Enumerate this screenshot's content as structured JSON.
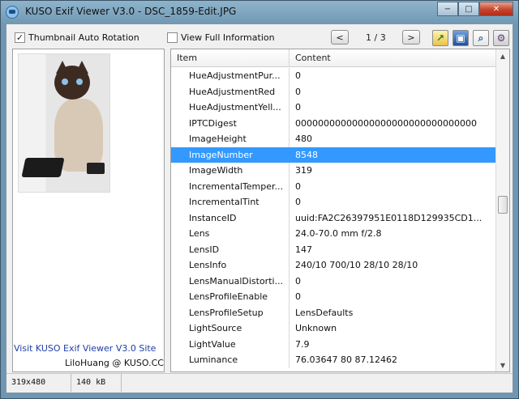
{
  "window": {
    "title": "KUSO Exif Viewer V3.0 - DSC_1859-Edit.JPG",
    "buttons": {
      "minimize": "−",
      "maximize": "□",
      "close": "✕"
    }
  },
  "toolbar": {
    "thumbnail_auto_rotation": {
      "label": "Thumbnail Auto Rotation",
      "checked": true,
      "mark": "✓"
    },
    "view_full_information": {
      "label": "View Full Information",
      "checked": false,
      "mark": ""
    },
    "prev_glyph": "<",
    "next_glyph": ">",
    "page_indicator": "1 / 3",
    "tools": [
      "open-folder-icon",
      "save-icon",
      "search-icon",
      "settings-icon"
    ]
  },
  "left_panel": {
    "site_link": "Visit KUSO Exif Viewer V3.0 Site",
    "credit": "LiloHuang @ KUSO.CC"
  },
  "table": {
    "columns": [
      "Item",
      "Content"
    ],
    "rows": [
      {
        "item": "HueAdjustmentPur...",
        "content": "0"
      },
      {
        "item": "HueAdjustmentRed",
        "content": "0"
      },
      {
        "item": "HueAdjustmentYell...",
        "content": "0"
      },
      {
        "item": "IPTCDigest",
        "content": "00000000000000000000000000000000"
      },
      {
        "item": "ImageHeight",
        "content": "480"
      },
      {
        "item": "ImageNumber",
        "content": "8548",
        "selected": true
      },
      {
        "item": "ImageWidth",
        "content": "319"
      },
      {
        "item": "IncrementalTemper...",
        "content": "0"
      },
      {
        "item": "IncrementalTint",
        "content": "0"
      },
      {
        "item": "InstanceID",
        "content": "uuid:FA2C26397951E0118D129935CD1..."
      },
      {
        "item": "Lens",
        "content": "24.0-70.0 mm f/2.8"
      },
      {
        "item": "LensID",
        "content": "147"
      },
      {
        "item": "LensInfo",
        "content": "240/10 700/10 28/10 28/10"
      },
      {
        "item": "LensManualDistorti...",
        "content": "0"
      },
      {
        "item": "LensProfileEnable",
        "content": "0"
      },
      {
        "item": "LensProfileSetup",
        "content": "LensDefaults"
      },
      {
        "item": "LightSource",
        "content": "Unknown"
      },
      {
        "item": "LightValue",
        "content": "7.9"
      },
      {
        "item": "Luminance",
        "content": "76.03647 80 87.12462"
      }
    ]
  },
  "status_bar": {
    "dimensions": "319x480",
    "file_size": "140 kB"
  },
  "colors": {
    "selection": "#3399ff",
    "link": "#1f3ea7"
  }
}
